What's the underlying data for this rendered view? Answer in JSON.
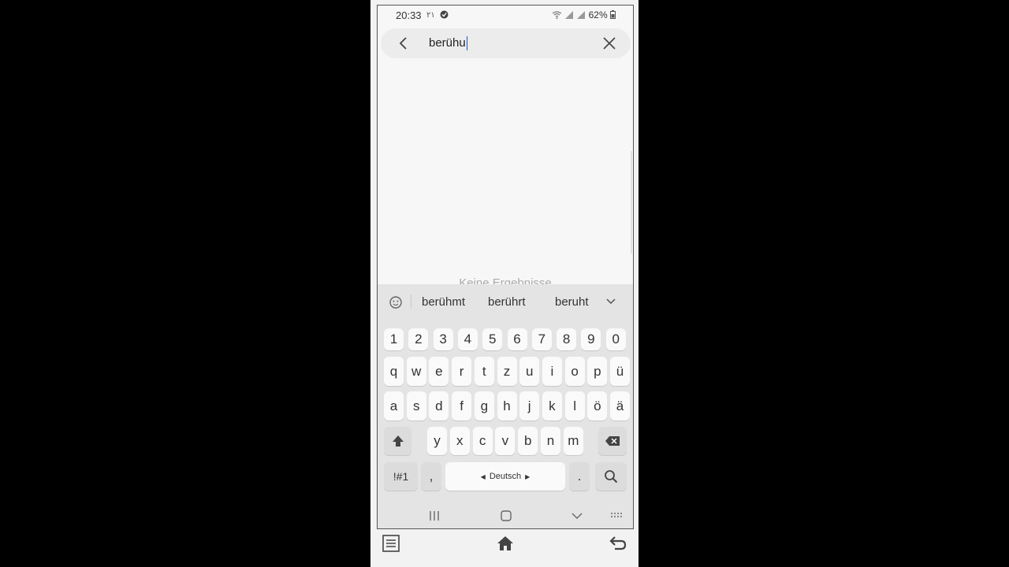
{
  "status_bar": {
    "time": "20:33",
    "extra": "٢١",
    "battery": "62%"
  },
  "search": {
    "query": "berühu"
  },
  "results": {
    "empty_text": "Keine Ergebnisse"
  },
  "suggestions": [
    "berühmt",
    "berührt",
    "beruht"
  ],
  "keyboard": {
    "row_numbers": [
      "1",
      "2",
      "3",
      "4",
      "5",
      "6",
      "7",
      "8",
      "9",
      "0"
    ],
    "row1": [
      "q",
      "w",
      "e",
      "r",
      "t",
      "z",
      "u",
      "i",
      "o",
      "p",
      "ü"
    ],
    "row2": [
      "a",
      "s",
      "d",
      "f",
      "g",
      "h",
      "j",
      "k",
      "l",
      "ö",
      "ä"
    ],
    "row3": [
      "y",
      "x",
      "c",
      "v",
      "b",
      "n",
      "m"
    ],
    "symbols_label": "!#1",
    "comma": ",",
    "space_label": "Deutsch",
    "period": "."
  }
}
